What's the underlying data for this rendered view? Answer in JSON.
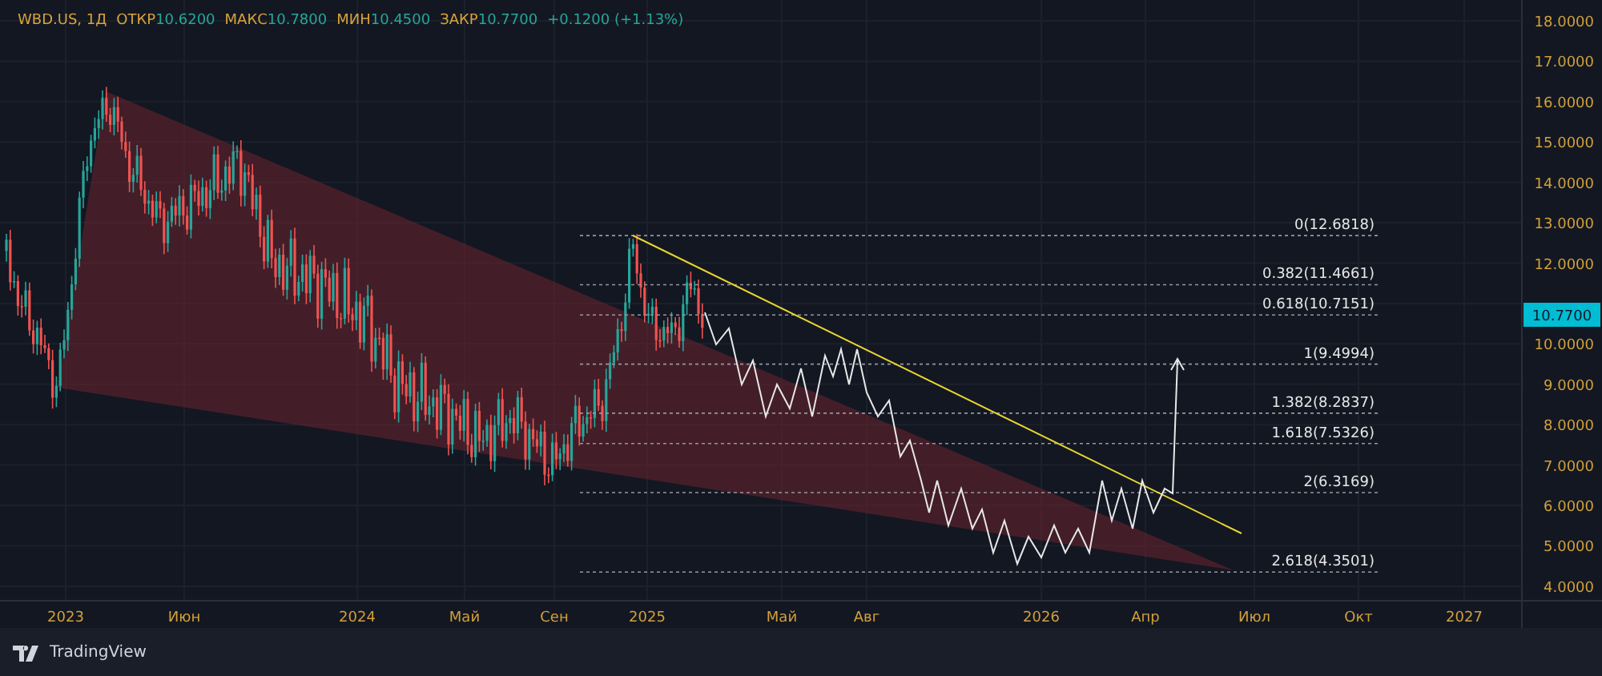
{
  "legend": {
    "symbol": "WBD.US, 1Д",
    "fields": [
      {
        "label": "ОТКР",
        "value": "10.6200"
      },
      {
        "label": "МАКС",
        "value": "10.7800"
      },
      {
        "label": "МИН",
        "value": "10.4500"
      },
      {
        "label": "ЗАКР",
        "value": "10.7700"
      }
    ],
    "change": "+0.1200 (+1.13%)"
  },
  "price_axis": [
    "18.0000",
    "17.0000",
    "16.0000",
    "15.0000",
    "14.0000",
    "13.0000",
    "12.0000",
    "10.0000",
    "9.0000",
    "8.0000",
    "7.0000",
    "6.0000",
    "5.0000",
    "4.0000"
  ],
  "current_price": "10.7700",
  "time_axis": [
    "2023",
    "Июн",
    "2024",
    "Май",
    "Сен",
    "2025",
    "Май",
    "Авг",
    "2026",
    "Апр",
    "Июл",
    "Окт",
    "2027"
  ],
  "fib_levels": [
    "0(12.6818)",
    "0.382(11.4661)",
    "0.618(10.7151)",
    "1(9.4994)",
    "1.382(8.2837)",
    "1.618(7.5326)",
    "2(6.3169)",
    "2.618(4.3501)"
  ],
  "footer": {
    "brand": "TradingView"
  }
}
